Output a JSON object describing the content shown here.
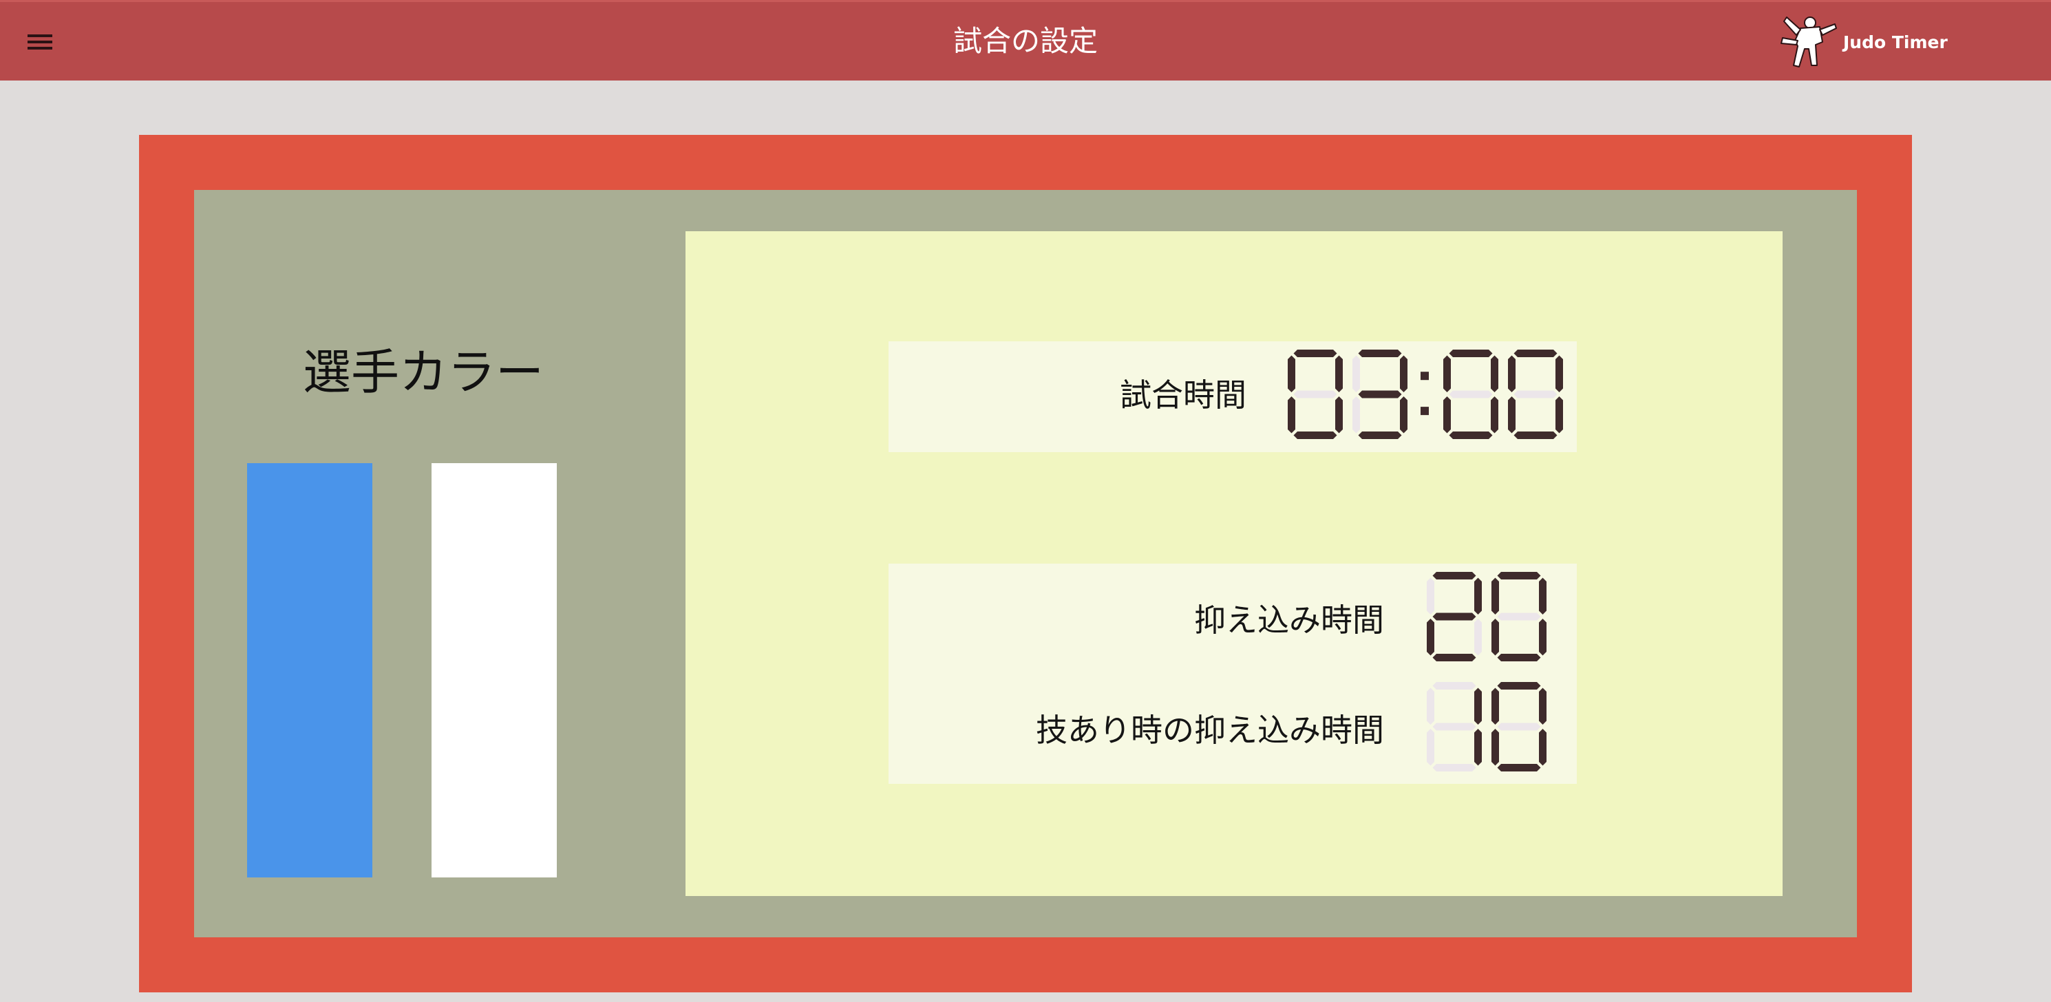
{
  "app_bar": {
    "menu_icon": "hamburger-menu-icon",
    "title": "試合の設定",
    "logo": {
      "text": "Judo Timer",
      "icon": "judo-throw-silhouette-icon"
    }
  },
  "player_colors": {
    "title": "選手カラー",
    "swatches": [
      {
        "name": "blue",
        "color": "#4a94ea"
      },
      {
        "name": "white",
        "color": "#ffffff"
      }
    ]
  },
  "timers": {
    "match_time": {
      "label": "試合時間",
      "value": "03:00"
    },
    "osaekomi_time": {
      "label": "抑え込み時間",
      "value": "20"
    },
    "waza_ari_osaekomi_time": {
      "label": "技あり時の抑え込み時間",
      "value": "10"
    }
  },
  "colors": {
    "app_bar": "#b74a4b",
    "mat_border": "#e05441",
    "mat_inner": "#a9ae94",
    "panel": "#f1f6c1",
    "card": "#f7f9e3",
    "digit_on": "#3f2b2c",
    "digit_off": "#ece6ea"
  }
}
